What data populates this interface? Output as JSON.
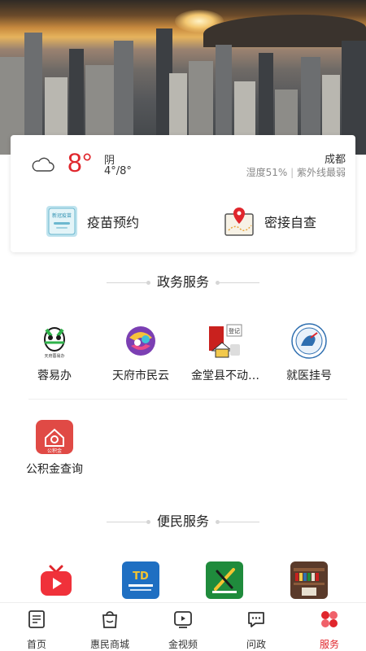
{
  "weather": {
    "temperature": "8°",
    "condition": "阴",
    "range": "4°/8°",
    "city": "成都",
    "humidity": "湿度51%",
    "separator": "|",
    "uv": "紫外线最弱",
    "icon": "cloud-icon"
  },
  "quick_actions": [
    {
      "label": "疫苗预约",
      "icon": "vaccine-icon",
      "icon_text": "新冠疫苗"
    },
    {
      "label": "密接自查",
      "icon": "map-pin-icon"
    }
  ],
  "gov_section": {
    "title": "政务服务",
    "items": [
      {
        "label": "蓉易办",
        "icon": "panda-icon",
        "icon_text": "天府蓉易办"
      },
      {
        "label": "天府市民云",
        "icon": "citizen-cloud-icon"
      },
      {
        "label": "金堂县不动…",
        "icon": "property-register-icon",
        "icon_text": "登记"
      },
      {
        "label": "就医挂号",
        "icon": "hospital-seal-icon"
      },
      {
        "label": "公积金查询",
        "icon": "housing-fund-icon",
        "icon_text": "公积金"
      }
    ]
  },
  "life_section": {
    "title": "便民服务",
    "items": [
      {
        "icon": "tv-play-icon"
      },
      {
        "icon": "td-service-icon",
        "icon_text": "TD"
      },
      {
        "icon": "employment-icon"
      },
      {
        "icon": "library-icon"
      }
    ]
  },
  "tabbar": {
    "tabs": [
      {
        "label": "首页",
        "icon": "home-doc-icon"
      },
      {
        "label": "惠民商城",
        "icon": "shopping-bag-icon"
      },
      {
        "label": "金视频",
        "icon": "video-play-icon"
      },
      {
        "label": "问政",
        "icon": "chat-bubble-icon"
      },
      {
        "label": "服务",
        "icon": "services-grid-icon",
        "active": true
      }
    ]
  },
  "colors": {
    "accent_red": "#e0262c",
    "text": "#222222",
    "muted": "#888888"
  }
}
